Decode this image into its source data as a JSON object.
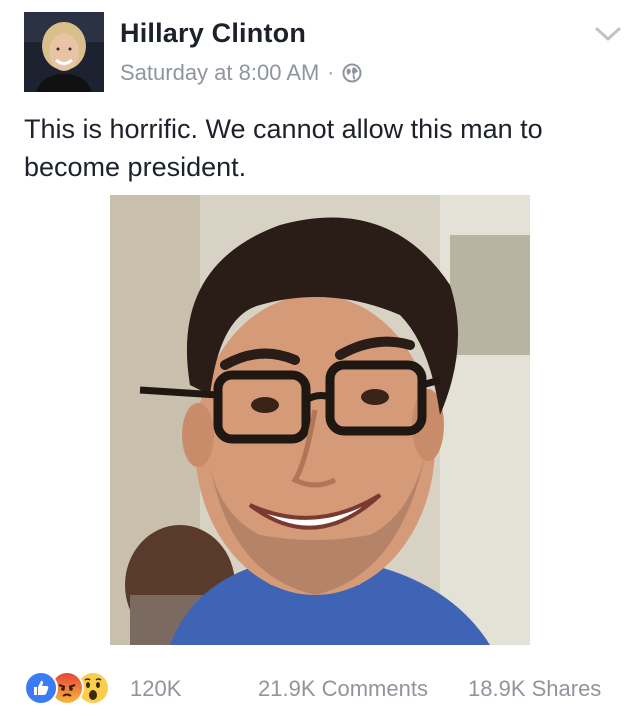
{
  "post": {
    "author_name": "Hillary Clinton",
    "timestamp": "Saturday at 8:00 AM",
    "separator": "·",
    "privacy_icon": "globe-icon",
    "menu_icon": "chevron-down-icon",
    "text": "This is horrific. We cannot allow this man to become president.",
    "photo_description": "portrait-photo"
  },
  "footer": {
    "reactions": [
      "like-icon",
      "angry-icon",
      "wow-icon"
    ],
    "reaction_count": "120K",
    "comments_label": "21.9K Comments",
    "shares_label": "18.9K Shares"
  },
  "colors": {
    "text_primary": "#1d2129",
    "text_secondary": "#90949c",
    "like_blue": "#3b7cf5",
    "angry_orange": "#f27a3c",
    "wow_yellow": "#fbcd4c"
  }
}
